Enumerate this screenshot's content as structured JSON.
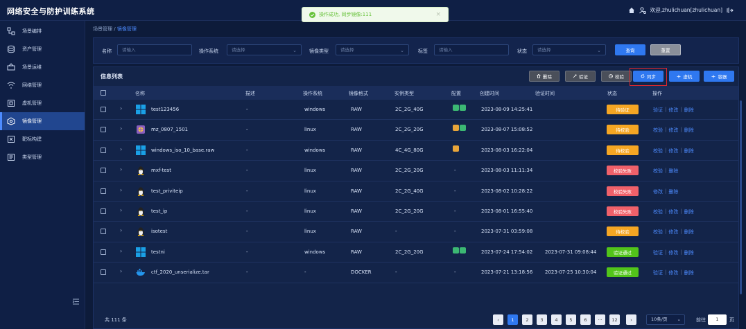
{
  "app": {
    "title": "网络安全与防护训练系统",
    "user": "欢迎,zhulichuan[zhulichuan]"
  },
  "toast": {
    "message": "操作成功, 同步镜像:111"
  },
  "sidebar": {
    "items": [
      {
        "label": "场景编排",
        "icon": "scene-icon"
      },
      {
        "label": "资产管理",
        "icon": "database-icon"
      },
      {
        "label": "场景运维",
        "icon": "ops-icon"
      },
      {
        "label": "网络管理",
        "icon": "network-icon"
      },
      {
        "label": "虚机管理",
        "icon": "vm-icon"
      },
      {
        "label": "镜像管理",
        "icon": "image-icon",
        "active": true
      },
      {
        "label": "靶标构建",
        "icon": "target-icon"
      },
      {
        "label": "类型管理",
        "icon": "type-icon"
      }
    ]
  },
  "breadcrumb": {
    "parent": "场景管理",
    "current": "镜像管理"
  },
  "filters": {
    "name_label": "名称",
    "name_placeholder": "请输入",
    "os_label": "操作系统",
    "os_placeholder": "请选择",
    "type_label": "镜像类型",
    "type_placeholder": "请选择",
    "tag_label": "标签",
    "tag_placeholder": "请输入",
    "status_label": "状态",
    "status_placeholder": "请选择",
    "query_button": "查询",
    "reset_button": "重置"
  },
  "list": {
    "title": "信息列表",
    "actions": {
      "delete": "删除",
      "verify": "验证",
      "check": "校验",
      "sync": "同步",
      "vm": "虚机",
      "container": "容器"
    },
    "columns": {
      "name": "名称",
      "desc": "描述",
      "os": "操作系统",
      "format": "镜像格式",
      "instance": "实例类型",
      "config": "配置",
      "created": "创建时间",
      "verified": "验证时间",
      "status": "状态",
      "ops": "操作"
    },
    "rows": [
      {
        "name": "test123456",
        "desc": "-",
        "os": "windows",
        "format": "RAW",
        "instance": "2C_2G_40G",
        "created": "2023-08-09 14:25:41",
        "verified": "",
        "status": "待验证",
        "status_color": "#f5a623",
        "os_icon": "windows-icon",
        "config": [
          "green",
          "green"
        ],
        "ops": [
          "验证",
          "修改",
          "删除"
        ]
      },
      {
        "name": "mz_0807_1501",
        "desc": "-",
        "os": "linux",
        "format": "RAW",
        "instance": "2C_2G_20G",
        "created": "2023-08-07 15:08:52",
        "verified": "",
        "status": "待校验",
        "status_color": "#f5a623",
        "os_icon": "app-icon",
        "config": [
          "orange",
          "green"
        ],
        "ops": [
          "校验",
          "修改",
          "删除"
        ]
      },
      {
        "name": "windows_iso_10_base.raw",
        "desc": "-",
        "os": "windows",
        "format": "RAW",
        "instance": "4C_4G_80G",
        "created": "2023-08-03 16:22:04",
        "verified": "",
        "status": "待校验",
        "status_color": "#f5a623",
        "os_icon": "windows-icon",
        "config": [
          "orange"
        ],
        "ops": [
          "校验",
          "修改",
          "删除"
        ]
      },
      {
        "name": "mxf-test",
        "desc": "-",
        "os": "linux",
        "format": "RAW",
        "instance": "2C_2G_20G",
        "created": "2023-08-03 11:11:34",
        "verified": "",
        "status": "校验失败",
        "status_color": "#f0616a",
        "os_icon": "linux-icon",
        "config": [],
        "config_text": "-",
        "ops": [
          "校验",
          "删除"
        ]
      },
      {
        "name": "test_priviteip",
        "desc": "-",
        "os": "linux",
        "format": "RAW",
        "instance": "2C_2G_40G",
        "created": "2023-08-02 10:28:22",
        "verified": "",
        "status": "校验失败",
        "status_color": "#f0616a",
        "os_icon": "linux-icon",
        "config": [],
        "config_text": "-",
        "ops": [
          "修改",
          "删除"
        ]
      },
      {
        "name": "test_ip",
        "desc": "-",
        "os": "linux",
        "format": "RAW",
        "instance": "2C_2G_20G",
        "created": "2023-08-01 16:55:40",
        "verified": "",
        "status": "校验失败",
        "status_color": "#f0616a",
        "os_icon": "linux-icon",
        "config": [],
        "config_text": "-",
        "ops": [
          "校验",
          "修改",
          "删除"
        ]
      },
      {
        "name": "isotest",
        "desc": "-",
        "os": "linux",
        "format": "RAW",
        "instance": "-",
        "created": "2023-07-31 03:59:08",
        "verified": "",
        "status": "待校验",
        "status_color": "#f5a623",
        "os_icon": "linux-icon",
        "config": [],
        "config_text": "-",
        "ops": [
          "校验",
          "修改",
          "删除"
        ]
      },
      {
        "name": "testni",
        "desc": "-",
        "os": "windows",
        "format": "RAW",
        "instance": "2C_2G_20G",
        "created": "2023-07-24 17:54:02",
        "verified": "2023-07-31 09:08:44",
        "status": "验证通过",
        "status_color": "#52c41a",
        "os_icon": "windows-icon",
        "config": [
          "green",
          "green"
        ],
        "ops": [
          "验证",
          "修改",
          "删除"
        ]
      },
      {
        "name": "ctf_2020_unserialize.tar",
        "desc": "-",
        "os": "-",
        "format": "DOCKER",
        "instance": "-",
        "created": "2023-07-21 13:18:56",
        "verified": "2023-07-25 10:30:04",
        "status": "验证通过",
        "status_color": "#52c41a",
        "os_icon": "docker-icon",
        "config": [],
        "config_text": "-",
        "ops": [
          "验证",
          "修改",
          "删除"
        ]
      }
    ]
  },
  "pagination": {
    "total": "共 111 条",
    "pages": [
      "1",
      "2",
      "3",
      "4",
      "5",
      "6",
      "···",
      "12"
    ],
    "current": "1",
    "page_size": "10条/页",
    "goto_label": "前往",
    "goto_value": "1",
    "page_unit": "页"
  }
}
